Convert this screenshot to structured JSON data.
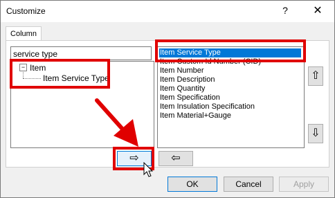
{
  "window": {
    "title": "Customize",
    "help_glyph": "?",
    "close_glyph": "✕"
  },
  "tabs": [
    {
      "label": "Column"
    }
  ],
  "search": {
    "value": "service type"
  },
  "tree": {
    "root": {
      "label": "Item",
      "expander": "−"
    },
    "child": {
      "label": "Item Service Type"
    }
  },
  "columns": {
    "items": [
      "Item Service Type",
      "Item Custom Id Number (CID)",
      "Item Number",
      "Item Description",
      "Item Quantity",
      "Item Specification",
      "Item Insulation Specification",
      "Item Material+Gauge"
    ],
    "selected_index": 0
  },
  "icons": {
    "move_up": "⇧",
    "move_down": "⇩",
    "add": "⇨",
    "remove": "⇦"
  },
  "buttons": {
    "ok": "OK",
    "cancel": "Cancel",
    "apply": "Apply"
  },
  "colors": {
    "highlight": "#0078d7",
    "annotation": "#e00000"
  }
}
